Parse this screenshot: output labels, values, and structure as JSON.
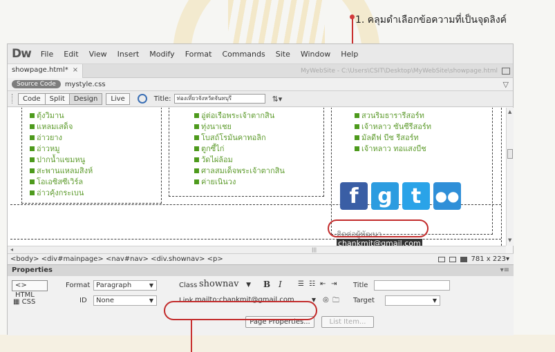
{
  "callout": {
    "text": "1. คลุมดำเลือกข้อความที่เป็นจุดลิงค์"
  },
  "app": {
    "logo": "Dw",
    "menu": [
      "File",
      "Edit",
      "View",
      "Insert",
      "Modify",
      "Format",
      "Commands",
      "Site",
      "Window",
      "Help"
    ]
  },
  "doc": {
    "tab": "showpage.html*",
    "path": "MyWebSite - C:\\Users\\CSIT\\Desktop\\MyWebSite\\showpage.html",
    "source_code": "Source Code",
    "related_file": "mystyle.css"
  },
  "toolbar": {
    "buttons": [
      "Code",
      "Split",
      "Design"
    ],
    "live": "Live",
    "title_label": "Title:",
    "title_value": "ท่องเที่ยวจังหวัดจันทบุรี"
  },
  "design": {
    "col1_items": [
      "ตุ้งวิมาน",
      "แหลมเสด็จ",
      "อ่าวยาง",
      "อ่าวหมู",
      "ปากน้ำแขมหนู",
      "สะพานแหลมสิงห์",
      "โอเอซิสซีเวิร์ล",
      "อ่าวคุ้งกระเบน"
    ],
    "col2_items": [
      "อู่ต่อเรือพระเจ้าตากสิน",
      "ทุ่งนาเชย",
      "โบสถ์โรมันคาทอลิก",
      "ตูกซี้ไก่",
      "วัดไผ่ล้อม",
      "ศาลสมเด็จพระเจ้าตากสิน",
      "ค่ายเนินวง"
    ],
    "col3_items": [
      "สวนริมธารารีสอร์ท",
      "เจ้าหลาว ซันซีรีสอร์ท",
      "มัลดีฟ บีช รีสอร์ท",
      "เจ้าหลาว ทอแสงบีช"
    ],
    "contact_label": "ติดต่อผู้พัฒนา",
    "email": "chankmit@gmail.com"
  },
  "tagbar": {
    "path": "<body> <div#mainpage> <nav#nav> <div.shownav> <p>",
    "size": "781 x 223"
  },
  "properties": {
    "panel_title": "Properties",
    "html_button": "HTML",
    "css_button": "CSS",
    "format_label": "Format",
    "format_value": "Paragraph",
    "id_label": "ID",
    "id_value": "None",
    "class_label": "Class",
    "class_value": "shownav",
    "bold": "B",
    "italic": "I",
    "title_label": "Title",
    "link_label": "Link",
    "link_value": "mailto:chankmit@gmail.com",
    "target_label": "Target",
    "page_properties": "Page Properties...",
    "list_item": "List Item..."
  },
  "colors": {
    "highlight": "#c22a2a",
    "list_green": "#5d9b2c"
  }
}
